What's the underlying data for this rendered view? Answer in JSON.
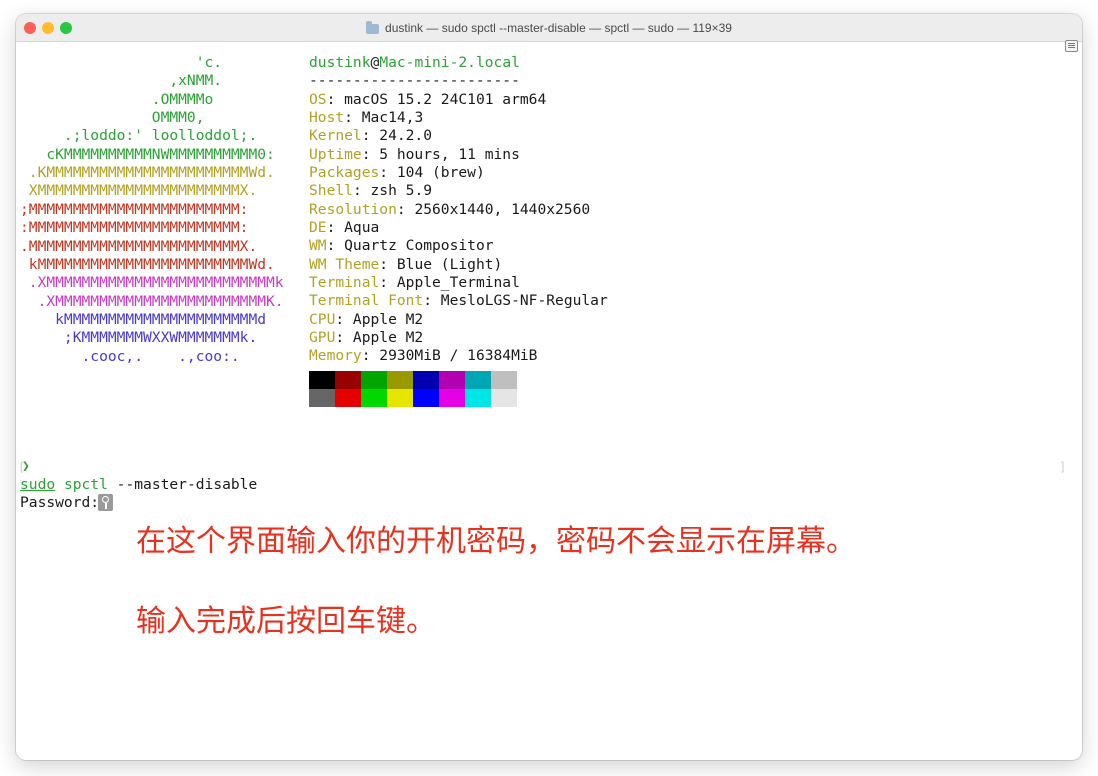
{
  "window": {
    "title": "dustink — sudo spctl --master-disable — spctl — sudo — 119×39"
  },
  "logo": [
    {
      "text": "                    'c.",
      "color": "#2aa234"
    },
    {
      "text": "                 ,xNMM.",
      "color": "#2aa234"
    },
    {
      "text": "               .OMMMMo",
      "color": "#2aa234"
    },
    {
      "text": "               OMMM0,",
      "color": "#2aa234"
    },
    {
      "text": "     .;loddo:' loolloddol;.",
      "color": "#2aa234"
    },
    {
      "text": "   cKMMMMMMMMMMNWMMMMMMMMMM0:",
      "color": "#2aa234"
    },
    {
      "text": " .KMMMMMMMMMMMMMMMMMMMMMMMWd.",
      "color": "#b1a223"
    },
    {
      "text": " XMMMMMMMMMMMMMMMMMMMMMMMX.",
      "color": "#b1a223"
    },
    {
      "text": ";MMMMMMMMMMMMMMMMMMMMMMMM:",
      "color": "#c23621"
    },
    {
      "text": ":MMMMMMMMMMMMMMMMMMMMMMMM:",
      "color": "#c23621"
    },
    {
      "text": ".MMMMMMMMMMMMMMMMMMMMMMMMX.",
      "color": "#c23621"
    },
    {
      "text": " kMMMMMMMMMMMMMMMMMMMMMMMMWd.",
      "color": "#c23621"
    },
    {
      "text": " .XMMMMMMMMMMMMMMMMMMMMMMMMMMk",
      "color": "#c839c5"
    },
    {
      "text": "  .XMMMMMMMMMMMMMMMMMMMMMMMMK.",
      "color": "#c839c5"
    },
    {
      "text": "    kMMMMMMMMMMMMMMMMMMMMMMd",
      "color": "#4b39cc"
    },
    {
      "text": "     ;KMMMMMMMWXXWMMMMMMMk.",
      "color": "#4b39cc"
    },
    {
      "text": "       .cooc,.    .,coo:.",
      "color": "#4b39cc"
    }
  ],
  "info": {
    "user": "dustink",
    "at": "@",
    "host": "Mac-mini-2.local",
    "separator": "------------------------",
    "items": [
      {
        "label": "OS",
        "value": ": macOS 15.2 24C101 arm64"
      },
      {
        "label": "Host",
        "value": ": Mac14,3"
      },
      {
        "label": "Kernel",
        "value": ": 24.2.0"
      },
      {
        "label": "Uptime",
        "value": ": 5 hours, 11 mins"
      },
      {
        "label": "Packages",
        "value": ": 104 (brew)"
      },
      {
        "label": "Shell",
        "value": ": zsh 5.9"
      },
      {
        "label": "Resolution",
        "value": ": 2560x1440, 1440x2560"
      },
      {
        "label": "DE",
        "value": ": Aqua"
      },
      {
        "label": "WM",
        "value": ": Quartz Compositor"
      },
      {
        "label": "WM Theme",
        "value": ": Blue (Light)"
      },
      {
        "label": "Terminal",
        "value": ": Apple_Terminal"
      },
      {
        "label": "Terminal Font",
        "value": ": MesloLGS-NF-Regular"
      },
      {
        "label": "CPU",
        "value": ": Apple M2"
      },
      {
        "label": "GPU",
        "value": ": Apple M2"
      },
      {
        "label": "Memory",
        "value": ": 2930MiB / 16384MiB"
      }
    ]
  },
  "palette": {
    "row1": [
      "#000000",
      "#990000",
      "#00a600",
      "#999900",
      "#0000b2",
      "#b200b2",
      "#00a6b2",
      "#bfbfbf"
    ],
    "row2": [
      "#666666",
      "#e50000",
      "#00d900",
      "#e5e500",
      "#0000ff",
      "#e500e5",
      "#00e5e5",
      "#e5e5e5"
    ]
  },
  "prompt": {
    "arrow": "❯",
    "sudo": "sudo",
    "spctl": "spctl",
    "args": " --master-disable",
    "password_label": "Password:"
  },
  "annotations": {
    "line1": "在这个界面输入你的开机密码，密码不会显示在屏幕。",
    "line2": "输入完成后按回车键。"
  }
}
